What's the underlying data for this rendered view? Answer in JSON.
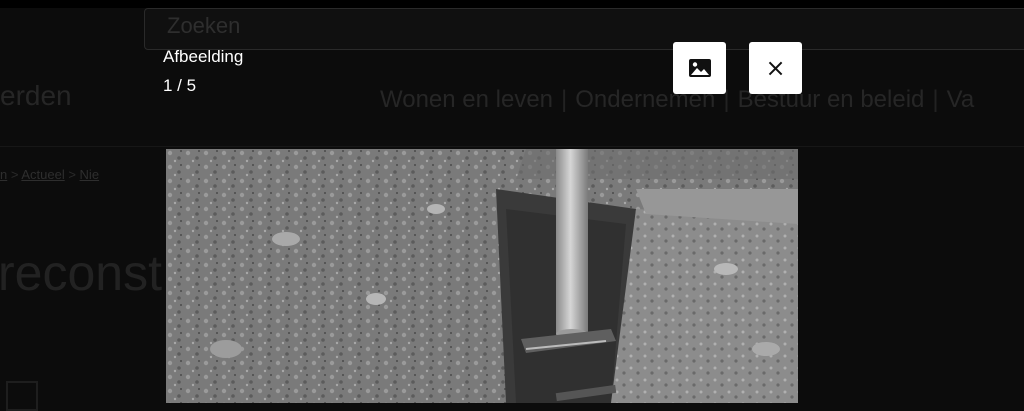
{
  "background_page": {
    "search_placeholder": "Zoeken",
    "site_name_fragment": "erden",
    "nav": [
      "Wonen en leven",
      "Ondernemen",
      "Bestuur en beleid",
      "Va"
    ],
    "breadcrumb": [
      "n",
      "Actueel",
      "Nie"
    ],
    "heading_fragment": "reconst"
  },
  "lightbox": {
    "title": "Afbeelding",
    "counter": "1 / 5",
    "image_icon": "image-icon",
    "close_icon": "close-icon",
    "close_glyph": "×"
  },
  "colors": {
    "overlay": "#0c0c0c",
    "button_bg": "#ffffff",
    "caption_text": "#ffffff"
  }
}
